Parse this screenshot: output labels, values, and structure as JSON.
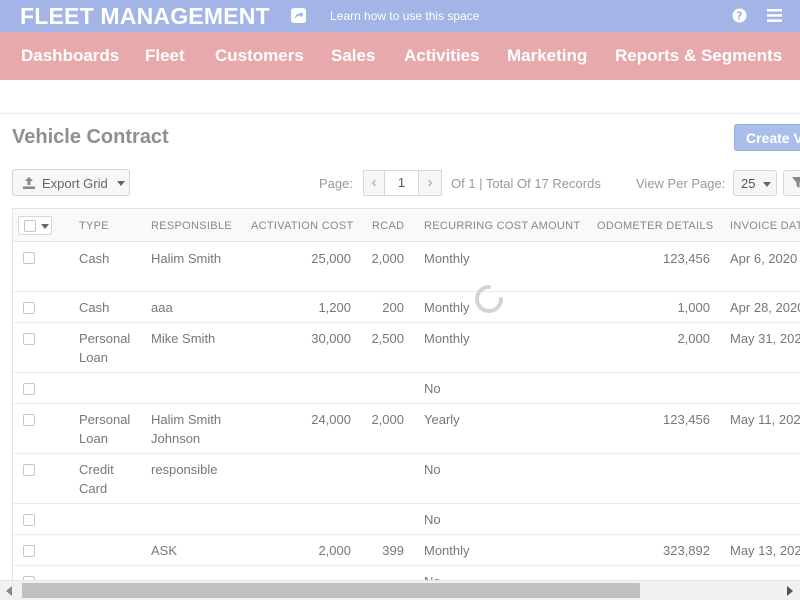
{
  "app": {
    "title": "FLEET MANAGEMENT",
    "learn_link": "Learn how to use this space",
    "accent_color": "#a3b4e6",
    "nav_color": "#e8a9ad"
  },
  "nav": {
    "items": [
      "Dashboards",
      "Fleet",
      "Customers",
      "Sales",
      "Activities",
      "Marketing",
      "Reports & Segments"
    ]
  },
  "page": {
    "title": "Vehicle Contract",
    "create_button": "Create V"
  },
  "toolbar": {
    "export_label": "Export Grid",
    "page_label": "Page:",
    "current_page": "1",
    "records_text": "Of 1 | Total Of 17 Records",
    "view_per_page_label": "View Per Page:",
    "per_page_value": "25"
  },
  "grid": {
    "columns": [
      "TYPE",
      "RESPONSIBLE",
      "ACTIVATION COST",
      "RCAD",
      "RECURRING COST AMOUNT",
      "ODOMETER DETAILS",
      "INVOICE DAT"
    ],
    "rows": [
      {
        "type": "Cash",
        "responsible": "Halim Smith",
        "activation_cost": "25,000",
        "rcad": "2,000",
        "recurring": "Monthly",
        "odometer": "123,456",
        "invoice_date": "Apr 6, 2020"
      },
      {
        "type": "Cash",
        "responsible": "aaa",
        "activation_cost": "1,200",
        "rcad": "200",
        "recurring": "Monthly",
        "odometer": "1,000",
        "invoice_date": "Apr 28, 2020"
      },
      {
        "type": "Personal Loan",
        "responsible": "Mike Smith",
        "activation_cost": "30,000",
        "rcad": "2,500",
        "recurring": "Monthly",
        "odometer": "2,000",
        "invoice_date": "May 31, 202"
      },
      {
        "type": "",
        "responsible": "",
        "activation_cost": "",
        "rcad": "",
        "recurring": "No",
        "odometer": "",
        "invoice_date": ""
      },
      {
        "type": "Personal Loan",
        "responsible": "Halim Smith Johnson",
        "activation_cost": "24,000",
        "rcad": "2,000",
        "recurring": "Yearly",
        "odometer": "123,456",
        "invoice_date": "May 11, 202"
      },
      {
        "type": "Credit Card",
        "responsible": "responsible",
        "activation_cost": "",
        "rcad": "",
        "recurring": "No",
        "odometer": "",
        "invoice_date": ""
      },
      {
        "type": "",
        "responsible": "",
        "activation_cost": "",
        "rcad": "",
        "recurring": "No",
        "odometer": "",
        "invoice_date": ""
      },
      {
        "type": "",
        "responsible": "ASK",
        "activation_cost": "2,000",
        "rcad": "399",
        "recurring": "Monthly",
        "odometer": "323,892",
        "invoice_date": "May 13, 202"
      },
      {
        "type": "",
        "responsible": "",
        "activation_cost": "",
        "rcad": "",
        "recurring": "No",
        "odometer": "",
        "invoice_date": ""
      }
    ]
  }
}
